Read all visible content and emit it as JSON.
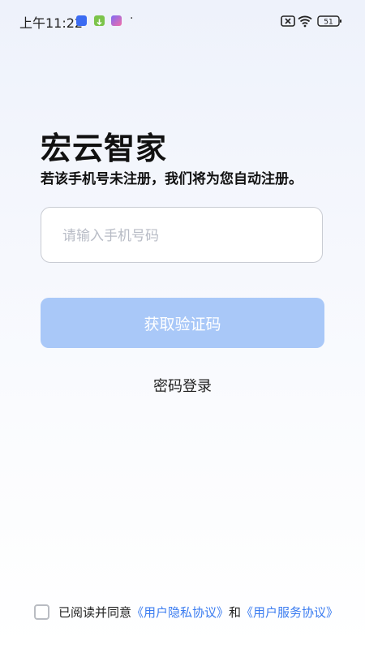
{
  "status_bar": {
    "time": "上午11:22",
    "dot": "·",
    "battery": "51",
    "icons": [
      "app-blue-icon",
      "download-icon",
      "app-pink-icon",
      "no-sim-icon",
      "wifi-icon",
      "battery-icon"
    ]
  },
  "page": {
    "title": "宏云智家",
    "subtitle": "若该手机号未注册，我们将为您自动注册。"
  },
  "phone_input": {
    "value": "",
    "placeholder": "请输入手机号码"
  },
  "get_code_button": {
    "label": "获取验证码"
  },
  "password_login": {
    "label": "密码登录"
  },
  "agreement": {
    "prefix": "已阅读并同意",
    "privacy_link": "《用户隐私协议》",
    "and": "和",
    "service_link": "《用户服务协议》",
    "checked": false
  },
  "colors": {
    "accent_button": "#a9c8f8",
    "link": "#3a7bf0"
  }
}
